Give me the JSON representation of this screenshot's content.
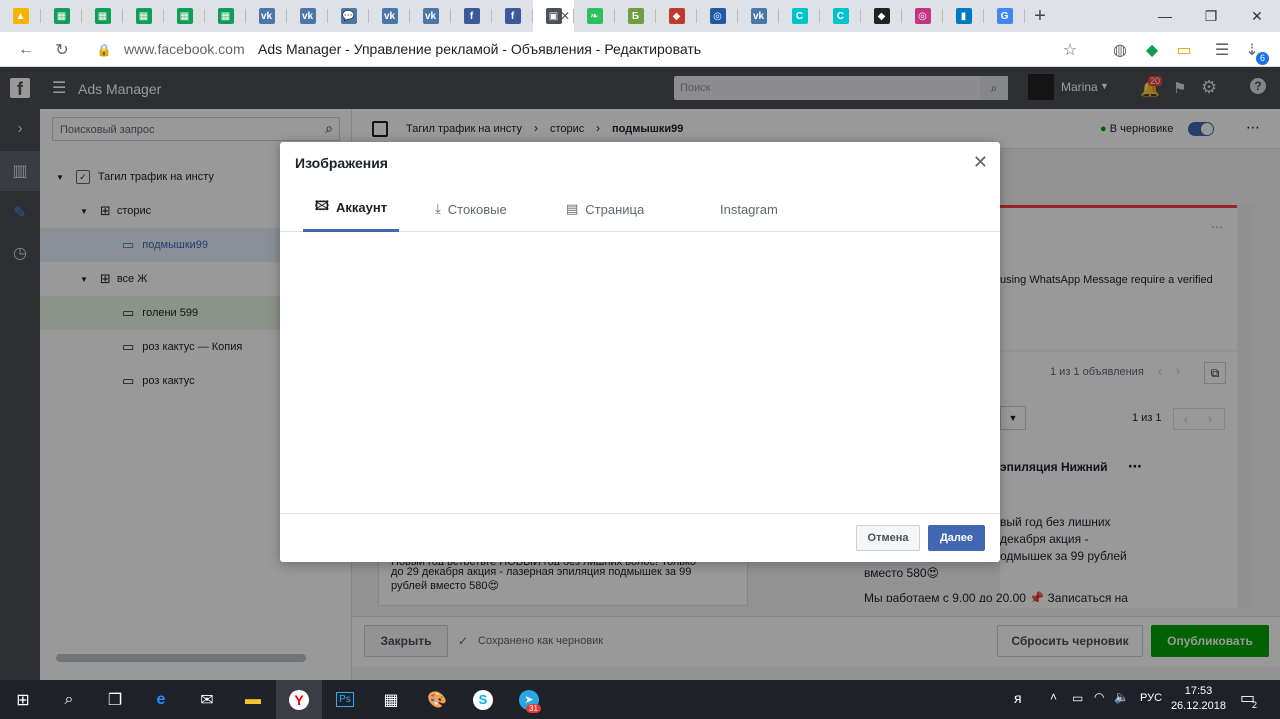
{
  "browser": {
    "tab_favicons": [
      {
        "icon": "google-drive-icon",
        "color": "#f4b400",
        "glyph": "▲"
      },
      {
        "icon": "sheets-icon",
        "color": "#0f9d58",
        "glyph": "▦"
      },
      {
        "icon": "sheets-icon",
        "color": "#0f9d58",
        "glyph": "▦"
      },
      {
        "icon": "sheets-icon",
        "color": "#0f9d58",
        "glyph": "▦"
      },
      {
        "icon": "sheets-icon",
        "color": "#0f9d58",
        "glyph": "▦"
      },
      {
        "icon": "sheets-icon",
        "color": "#0f9d58",
        "glyph": "▦"
      },
      {
        "icon": "vk-icon",
        "color": "#4a76a8",
        "glyph": "vk"
      },
      {
        "icon": "vk-icon",
        "color": "#4a76a8",
        "glyph": "vk"
      },
      {
        "icon": "chat-icon",
        "color": "#4a76a8",
        "glyph": "💬"
      },
      {
        "icon": "vk-icon",
        "color": "#4a76a8",
        "glyph": "vk"
      },
      {
        "icon": "vk-icon",
        "color": "#4a76a8",
        "glyph": "vk"
      },
      {
        "icon": "facebook-icon",
        "color": "#3b5998",
        "glyph": "f"
      },
      {
        "icon": "facebook-icon",
        "color": "#3b5998",
        "glyph": "f"
      },
      {
        "icon": "ads-manager-icon",
        "color": "#4b4f56",
        "glyph": "▣"
      },
      {
        "icon": "evernote-icon",
        "color": "#2dbe60",
        "glyph": "❧"
      },
      {
        "icon": "ruble-icon",
        "color": "#6d9e3c",
        "glyph": "Б"
      },
      {
        "icon": "ruby-icon",
        "color": "#c0392b",
        "glyph": "◆"
      },
      {
        "icon": "globe-icon",
        "color": "#1e5aa8",
        "glyph": "◎"
      },
      {
        "icon": "vk-icon",
        "color": "#4a76a8",
        "glyph": "vk"
      },
      {
        "icon": "canva-icon",
        "color": "#00c4cc",
        "glyph": "C"
      },
      {
        "icon": "canva-icon",
        "color": "#00c4cc",
        "glyph": "C"
      },
      {
        "icon": "diamond-icon",
        "color": "#222222",
        "glyph": "◆"
      },
      {
        "icon": "instagram-icon",
        "color": "#c13584",
        "glyph": "◎"
      },
      {
        "icon": "trello-icon",
        "color": "#0079bf",
        "glyph": "▮"
      },
      {
        "icon": "google-icon",
        "color": "#4285f4",
        "glyph": "G"
      }
    ],
    "url_domain": "www.facebook.com",
    "page_title": "Ads Manager - Управление рекламой - Объявления - Редактировать",
    "ext_badge": "6"
  },
  "fb": {
    "app_name": "Ads Manager",
    "search_placeholder": "Поиск",
    "user_name": "Marina",
    "notif_count": "20"
  },
  "tree": {
    "search_placeholder": "Поисковый запрос",
    "campaign": "Тагил трафик на инсту",
    "adset1": "сторис",
    "ad1": "подмышки99",
    "adset2": "все Ж",
    "ad2": "голени 599",
    "ad3": "роз кактус — Копия",
    "ad4": "роз кактус"
  },
  "main": {
    "breadcrumb": [
      "Тагил трафик на инсту",
      "сторис",
      "подмышки99"
    ],
    "draft_label": "В черновике",
    "warning_text": "using WhatsApp Message require a verified",
    "pager1": "1 из 1 объявления",
    "pager2": "1 из 1",
    "preview_title": "эпиляция Нижний",
    "preview_text_right": [
      "вый год без лишних",
      "декабря акция -",
      "одмышек за 99 рублей",
      "вместо 580😍",
      "Мы работаем с 9.00 до 20.00 📌 Записаться на"
    ],
    "preview_text_left": [
      "Новый год встретьте НОВЫЙ год без лишних волос! Только",
      "до 29 декабря акция - лазерная эпиляция подмышек за 99",
      "рублей вместо 580😍"
    ],
    "close_btn": "Закрыть",
    "saved_text": "Сохранено как черновик",
    "reset_btn": "Сбросить черновик",
    "publish_btn": "Опубликовать"
  },
  "dialog": {
    "title": "Изображения",
    "tabs": [
      {
        "label": "Аккаунт",
        "icon": "image-icon"
      },
      {
        "label": "Стоковые",
        "icon": "download-icon"
      },
      {
        "label": "Страница",
        "icon": "page-icon"
      },
      {
        "label": "Instagram",
        "icon": ""
      }
    ],
    "cancel": "Отмена",
    "next": "Далее"
  },
  "taskbar": {
    "lang": "РУС",
    "time": "17:53",
    "date": "26.12.2018",
    "telegram_badge": "31",
    "notif_badge": "2"
  }
}
